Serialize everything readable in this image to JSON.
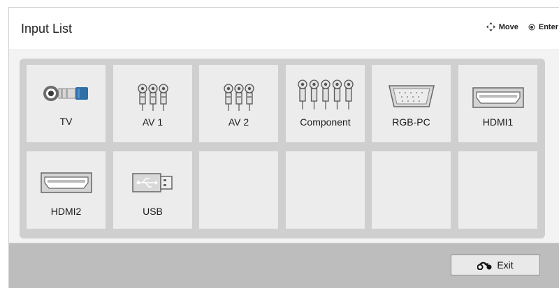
{
  "header": {
    "title": "Input List",
    "hints": {
      "move_label": "Move",
      "enter_label": "Enter"
    }
  },
  "inputs": [
    {
      "label": "TV",
      "icon": "coax-antenna-icon"
    },
    {
      "label": "AV 1",
      "icon": "rca-av-icon"
    },
    {
      "label": "AV 2",
      "icon": "rca-av-icon"
    },
    {
      "label": "Component",
      "icon": "rca-component-icon"
    },
    {
      "label": "RGB-PC",
      "icon": "vga-port-icon"
    },
    {
      "label": "HDMI1",
      "icon": "hdmi-port-icon"
    },
    {
      "label": "HDMI2",
      "icon": "hdmi-port-icon"
    },
    {
      "label": "USB",
      "icon": "usb-icon"
    }
  ],
  "footer": {
    "exit_label": "Exit"
  }
}
